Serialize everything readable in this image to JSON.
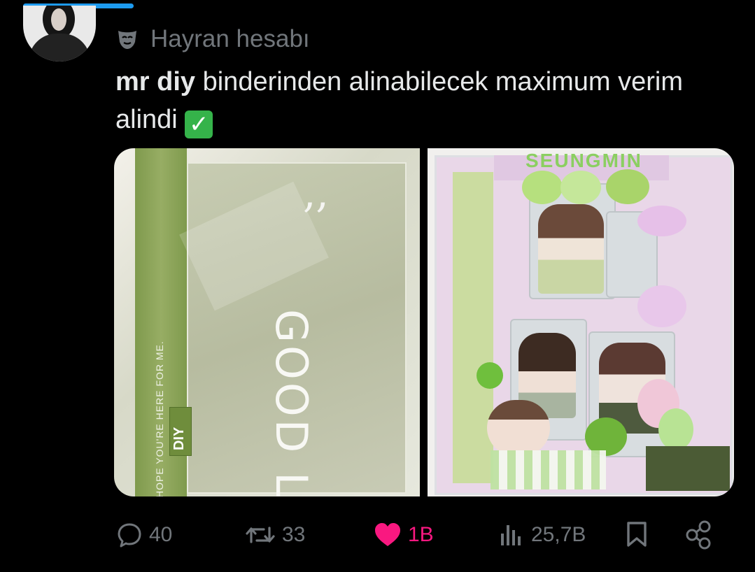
{
  "tweet": {
    "account_label": "Hayran hesabı",
    "text_bold": "mr diy",
    "text_rest": " binderinden alinabilecek maximum verim alindi ",
    "emoji": "check-mark-button"
  },
  "media": {
    "left_photo": {
      "binder_text": "GOOD LUCK",
      "quote": ",,",
      "tagline": "HOPE YOU'RE HERE FOR ME.",
      "brand": "DIY"
    },
    "right_photo": {
      "sticker_title": "SEUNGMIN"
    }
  },
  "actions": {
    "replies": "40",
    "reposts": "33",
    "likes": "1B",
    "views": "25,7B"
  },
  "colors": {
    "background": "#000000",
    "text_primary": "#e7e9ea",
    "text_secondary": "#71767b",
    "like": "#f91880",
    "progress": "#1d9bf0"
  },
  "icons": {
    "label": "mask-icon",
    "reply": "reply-icon",
    "repost": "repost-icon",
    "like": "heart-icon",
    "views": "views-icon",
    "bookmark": "bookmark-icon",
    "share": "share-icon"
  }
}
